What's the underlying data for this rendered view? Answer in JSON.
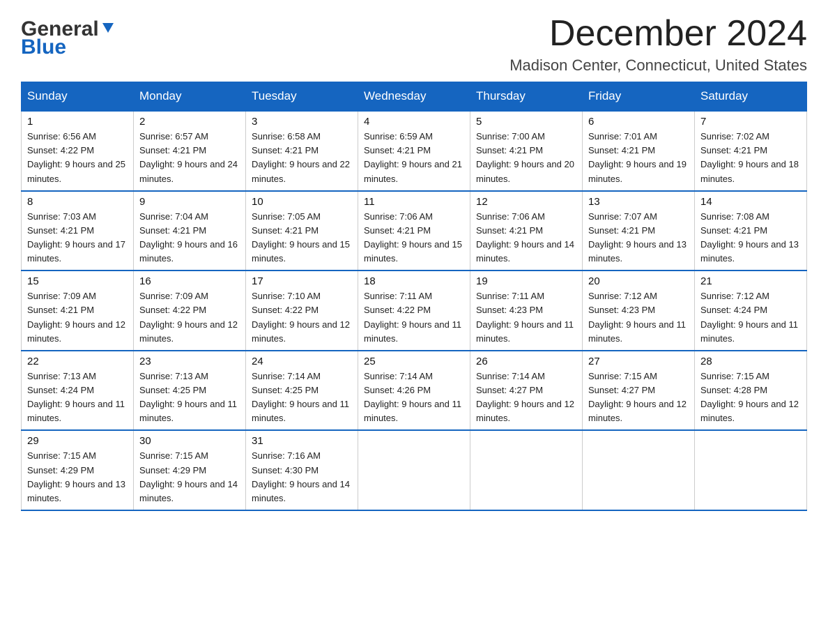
{
  "header": {
    "logo_general": "General",
    "logo_blue": "Blue",
    "month_title": "December 2024",
    "location": "Madison Center, Connecticut, United States"
  },
  "weekdays": [
    "Sunday",
    "Monday",
    "Tuesday",
    "Wednesday",
    "Thursday",
    "Friday",
    "Saturday"
  ],
  "weeks": [
    [
      {
        "day": "1",
        "sunrise": "6:56 AM",
        "sunset": "4:22 PM",
        "daylight": "9 hours and 25 minutes."
      },
      {
        "day": "2",
        "sunrise": "6:57 AM",
        "sunset": "4:21 PM",
        "daylight": "9 hours and 24 minutes."
      },
      {
        "day": "3",
        "sunrise": "6:58 AM",
        "sunset": "4:21 PM",
        "daylight": "9 hours and 22 minutes."
      },
      {
        "day": "4",
        "sunrise": "6:59 AM",
        "sunset": "4:21 PM",
        "daylight": "9 hours and 21 minutes."
      },
      {
        "day": "5",
        "sunrise": "7:00 AM",
        "sunset": "4:21 PM",
        "daylight": "9 hours and 20 minutes."
      },
      {
        "day": "6",
        "sunrise": "7:01 AM",
        "sunset": "4:21 PM",
        "daylight": "9 hours and 19 minutes."
      },
      {
        "day": "7",
        "sunrise": "7:02 AM",
        "sunset": "4:21 PM",
        "daylight": "9 hours and 18 minutes."
      }
    ],
    [
      {
        "day": "8",
        "sunrise": "7:03 AM",
        "sunset": "4:21 PM",
        "daylight": "9 hours and 17 minutes."
      },
      {
        "day": "9",
        "sunrise": "7:04 AM",
        "sunset": "4:21 PM",
        "daylight": "9 hours and 16 minutes."
      },
      {
        "day": "10",
        "sunrise": "7:05 AM",
        "sunset": "4:21 PM",
        "daylight": "9 hours and 15 minutes."
      },
      {
        "day": "11",
        "sunrise": "7:06 AM",
        "sunset": "4:21 PM",
        "daylight": "9 hours and 15 minutes."
      },
      {
        "day": "12",
        "sunrise": "7:06 AM",
        "sunset": "4:21 PM",
        "daylight": "9 hours and 14 minutes."
      },
      {
        "day": "13",
        "sunrise": "7:07 AM",
        "sunset": "4:21 PM",
        "daylight": "9 hours and 13 minutes."
      },
      {
        "day": "14",
        "sunrise": "7:08 AM",
        "sunset": "4:21 PM",
        "daylight": "9 hours and 13 minutes."
      }
    ],
    [
      {
        "day": "15",
        "sunrise": "7:09 AM",
        "sunset": "4:21 PM",
        "daylight": "9 hours and 12 minutes."
      },
      {
        "day": "16",
        "sunrise": "7:09 AM",
        "sunset": "4:22 PM",
        "daylight": "9 hours and 12 minutes."
      },
      {
        "day": "17",
        "sunrise": "7:10 AM",
        "sunset": "4:22 PM",
        "daylight": "9 hours and 12 minutes."
      },
      {
        "day": "18",
        "sunrise": "7:11 AM",
        "sunset": "4:22 PM",
        "daylight": "9 hours and 11 minutes."
      },
      {
        "day": "19",
        "sunrise": "7:11 AM",
        "sunset": "4:23 PM",
        "daylight": "9 hours and 11 minutes."
      },
      {
        "day": "20",
        "sunrise": "7:12 AM",
        "sunset": "4:23 PM",
        "daylight": "9 hours and 11 minutes."
      },
      {
        "day": "21",
        "sunrise": "7:12 AM",
        "sunset": "4:24 PM",
        "daylight": "9 hours and 11 minutes."
      }
    ],
    [
      {
        "day": "22",
        "sunrise": "7:13 AM",
        "sunset": "4:24 PM",
        "daylight": "9 hours and 11 minutes."
      },
      {
        "day": "23",
        "sunrise": "7:13 AM",
        "sunset": "4:25 PM",
        "daylight": "9 hours and 11 minutes."
      },
      {
        "day": "24",
        "sunrise": "7:14 AM",
        "sunset": "4:25 PM",
        "daylight": "9 hours and 11 minutes."
      },
      {
        "day": "25",
        "sunrise": "7:14 AM",
        "sunset": "4:26 PM",
        "daylight": "9 hours and 11 minutes."
      },
      {
        "day": "26",
        "sunrise": "7:14 AM",
        "sunset": "4:27 PM",
        "daylight": "9 hours and 12 minutes."
      },
      {
        "day": "27",
        "sunrise": "7:15 AM",
        "sunset": "4:27 PM",
        "daylight": "9 hours and 12 minutes."
      },
      {
        "day": "28",
        "sunrise": "7:15 AM",
        "sunset": "4:28 PM",
        "daylight": "9 hours and 12 minutes."
      }
    ],
    [
      {
        "day": "29",
        "sunrise": "7:15 AM",
        "sunset": "4:29 PM",
        "daylight": "9 hours and 13 minutes."
      },
      {
        "day": "30",
        "sunrise": "7:15 AM",
        "sunset": "4:29 PM",
        "daylight": "9 hours and 14 minutes."
      },
      {
        "day": "31",
        "sunrise": "7:16 AM",
        "sunset": "4:30 PM",
        "daylight": "9 hours and 14 minutes."
      },
      null,
      null,
      null,
      null
    ]
  ]
}
